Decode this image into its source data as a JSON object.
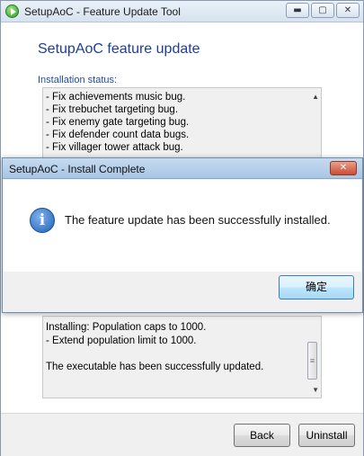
{
  "window": {
    "title": "SetupAoC - Feature Update Tool",
    "controls": {
      "minimize": "▬",
      "maximize": "▢",
      "close": "✕"
    }
  },
  "header": {
    "title": "SetupAoC feature update"
  },
  "status": {
    "label": "Installation status:",
    "log_top": [
      "- Fix achievements music bug.",
      "- Fix trebuchet targeting bug.",
      "- Fix enemy gate targeting bug.",
      "- Fix defender count data bugs.",
      "- Fix villager tower attack bug."
    ],
    "log_bottom": [
      "Installing: Population caps to 1000.",
      "- Extend population limit to 1000.",
      "",
      "The executable has been successfully updated."
    ],
    "scroll_up_glyph": "▲",
    "scroll_down_glyph": "▼",
    "thumb_grip": "≡"
  },
  "footer": {
    "back_label": "Back",
    "install_label": "Uninstall"
  },
  "dialog": {
    "title": "SetupAoC - Install Complete",
    "close_glyph": "✕",
    "icon_glyph": "i",
    "message": "The feature update has been successfully installed.",
    "ok_label": "确定"
  },
  "icons": {
    "app": "app-play-icon",
    "info": "info-icon"
  },
  "colors": {
    "header_text": "#1e3f95",
    "dialog_title_bg": "#b7d0eb",
    "close_button": "#c94d33"
  }
}
